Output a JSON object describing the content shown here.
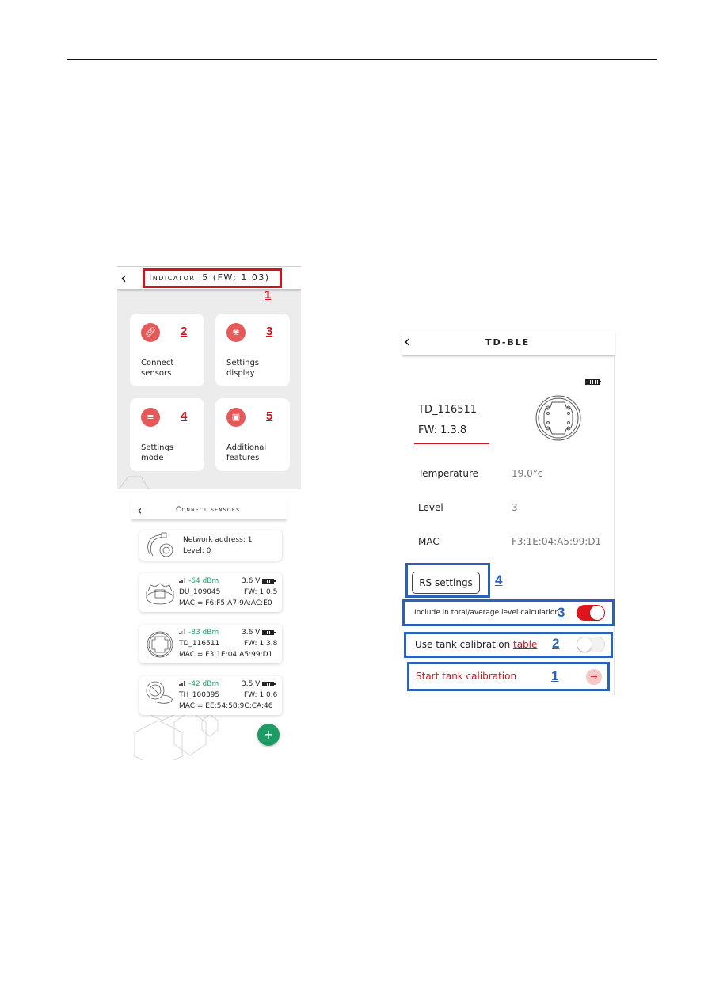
{
  "indicator_screen": {
    "back_icon": "chevron-left-icon",
    "title": "Indicator i5 (FW: 1.03)",
    "annotation": "1",
    "tiles": [
      {
        "label_line1": "Connect",
        "label_line2": "sensors",
        "icon": "link-icon",
        "annotation": "2"
      },
      {
        "label_line1": "Settings",
        "label_line2": "display",
        "icon": "gear-flower-icon",
        "annotation": "3"
      },
      {
        "label_line1": "Settings",
        "label_line2": "mode",
        "icon": "sliders-icon",
        "annotation": "4"
      },
      {
        "label_line1": "Additional",
        "label_line2": "features",
        "icon": "folder-plus-icon",
        "annotation": "5"
      }
    ]
  },
  "connect_screen": {
    "back_icon": "chevron-left-icon",
    "title": "Connect sensors",
    "cards": [
      {
        "type": "network",
        "network_address": "Network address: 1",
        "level": "Level: 0"
      },
      {
        "signal": "-64 dBm",
        "voltage": "3.6 V",
        "name": "DU_109045",
        "fw": "FW: 1.0.5",
        "mac": "MAC = F6:F5:A7:9A:AC:E0"
      },
      {
        "signal": "-83 dBm",
        "voltage": "3.6 V",
        "name": "TD_116511",
        "fw": "FW: 1.3.8",
        "mac": "MAC = F3:1E:04:A5:99:D1"
      },
      {
        "signal": "-42 dBm",
        "voltage": "3.5 V",
        "name": "TH_100395",
        "fw": "FW: 1.0.6",
        "mac": "MAC = EE:54:58:9C:CA:46"
      }
    ],
    "fab_label": "+"
  },
  "td_screen": {
    "back_icon": "chevron-left-icon",
    "title": "TD-BLE",
    "sensor_name": "TD_116511",
    "fw": "FW: 1.3.8",
    "rows": [
      {
        "label": "Temperature",
        "value": "19.0°c"
      },
      {
        "label": "Level",
        "value": "3"
      },
      {
        "label": "MAC",
        "value": "F3:1E:04:A5:99:D1"
      }
    ],
    "rs_button": "RS settings",
    "rs_annotation": "4",
    "include_label": "Include in total/average level calculation",
    "include_annotation": "3",
    "include_on": true,
    "calib_label": "Use tank calibration",
    "calib_link": "table",
    "calib_annotation": "2",
    "calib_on": false,
    "start_label": "Start tank calibration",
    "start_annotation": "1",
    "start_arrow": "→"
  },
  "colors": {
    "accent_red": "#d0141e",
    "tile_icon_red": "#e45a5a",
    "annotation_blue": "#2b62b8",
    "signal_green": "#1aa46a",
    "fab_green": "#1e9a64"
  }
}
